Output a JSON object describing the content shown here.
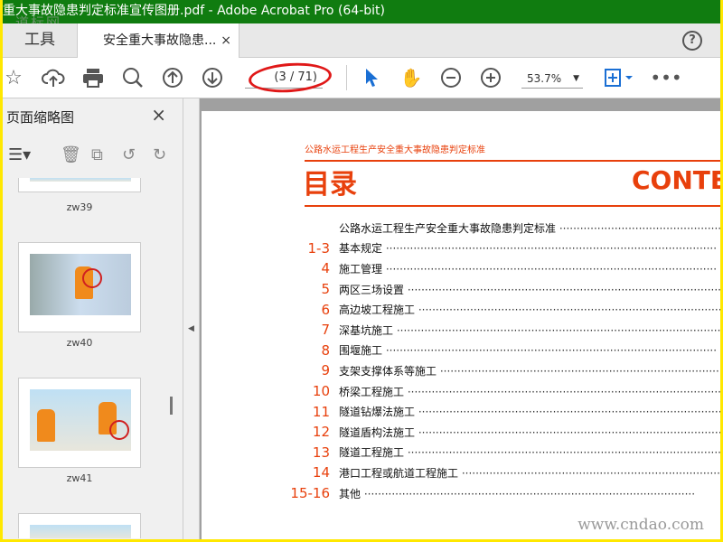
{
  "window": {
    "title": "重大事故隐患判定标准宣传图册.pdf - Adobe Acrobat Pro (64-bit)"
  },
  "tabs": {
    "tools": "工具",
    "doc": "安全重大事故隐患...",
    "close": "×",
    "help": "?"
  },
  "toolbar": {
    "page_indicator": "(3 / 71)",
    "zoom": "53.7%"
  },
  "left_panel": {
    "title": "页面缩略图",
    "close": "×",
    "thumbnails": [
      {
        "label": "zw39"
      },
      {
        "label": "zw40"
      },
      {
        "label": "zw41"
      }
    ]
  },
  "page": {
    "subtitle": "公路水运工程生产安全重大事故隐患判定标准",
    "title": "目录",
    "title_en": "CONTE",
    "toc": [
      {
        "num": "",
        "text": "公路水运工程生产安全重大事故隐患判定标准"
      },
      {
        "num": "1-3",
        "text": "基本规定"
      },
      {
        "num": "4",
        "text": "施工管理"
      },
      {
        "num": "5",
        "text": "两区三场设置"
      },
      {
        "num": "6",
        "text": "高边坡工程施工"
      },
      {
        "num": "7",
        "text": "深基坑施工"
      },
      {
        "num": "8",
        "text": "围堰施工"
      },
      {
        "num": "9",
        "text": "支架支撑体系等施工"
      },
      {
        "num": "10",
        "text": "桥梁工程施工"
      },
      {
        "num": "11",
        "text": "隧道钻爆法施工"
      },
      {
        "num": "12",
        "text": "隧道盾构法施工"
      },
      {
        "num": "13",
        "text": "隧道工程施工"
      },
      {
        "num": "14",
        "text": "港口工程或航道工程施工"
      },
      {
        "num": "15-16",
        "text": "其他"
      }
    ]
  },
  "watermark": {
    "url": "www.cndao.com",
    "logo": "道标网"
  }
}
